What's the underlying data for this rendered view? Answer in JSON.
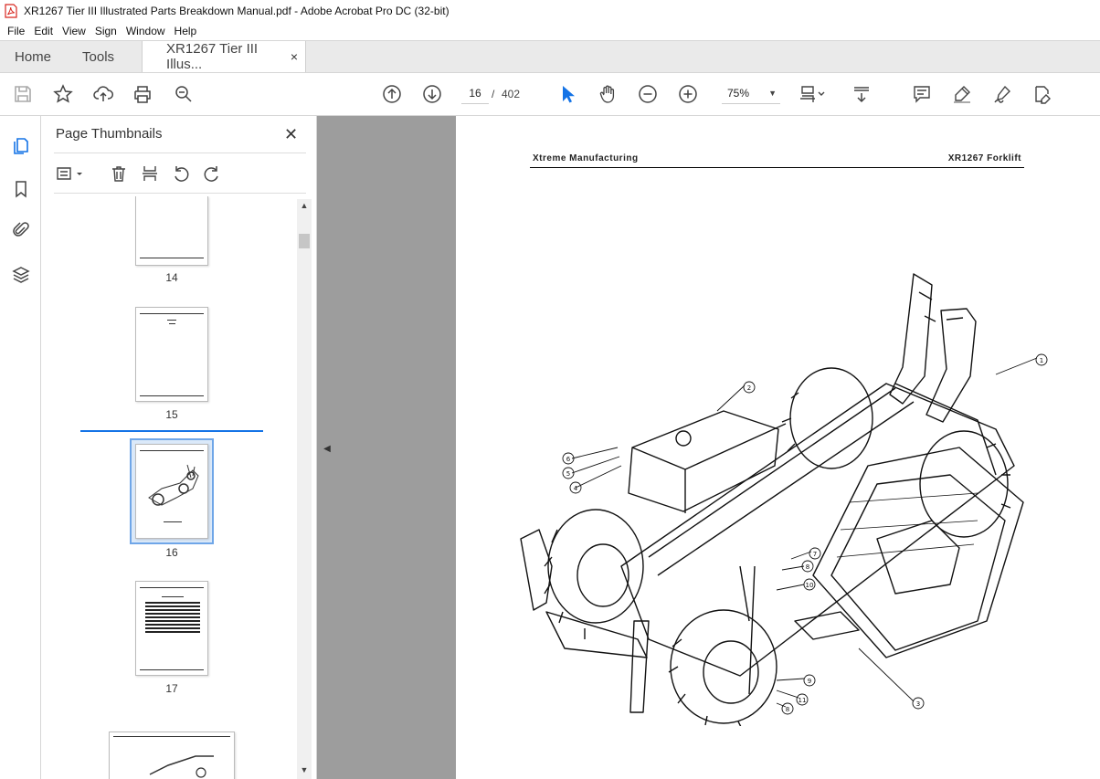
{
  "window": {
    "title": "XR1267 Tier III Illustrated Parts Breakdown Manual.pdf - Adobe Acrobat Pro DC (32-bit)"
  },
  "menu": [
    "File",
    "Edit",
    "View",
    "Sign",
    "Window",
    "Help"
  ],
  "tabs": {
    "home": "Home",
    "tools": "Tools",
    "doc": "XR1267 Tier III Illus...",
    "close": "×"
  },
  "toolbar": {
    "page_current": "16",
    "page_sep": "/",
    "page_total": "402",
    "zoom": "75%",
    "icons": [
      "save-icon",
      "bookmark-star-icon",
      "upload-icon",
      "print-icon",
      "zoom-search-icon",
      "page-up-icon",
      "page-down-icon",
      "select-arrow-icon",
      "hand-icon",
      "zoom-out-icon",
      "zoom-in-icon",
      "zoom-dropdown-icon",
      "fit-page-icon",
      "scroll-mode-icon",
      "comment-icon",
      "highlight-icon",
      "sign-icon",
      "edit-pdf-icon"
    ]
  },
  "panel": {
    "title": "Page Thumbnails",
    "close": "✕",
    "thumbnails": [
      {
        "label": "14"
      },
      {
        "label": "15"
      },
      {
        "label": "16",
        "selected": true
      },
      {
        "label": "17"
      }
    ]
  },
  "document": {
    "header_left": "Xtreme Manufacturing",
    "header_right": "XR1267 Forklift",
    "callouts": [
      "1",
      "2",
      "3",
      "4",
      "5",
      "6",
      "7",
      "8",
      "9",
      "10",
      "11",
      "8"
    ]
  },
  "colors": {
    "accent": "#1473e6",
    "pdf_red": "#d7261e",
    "doc_bg": "#9d9d9d"
  }
}
